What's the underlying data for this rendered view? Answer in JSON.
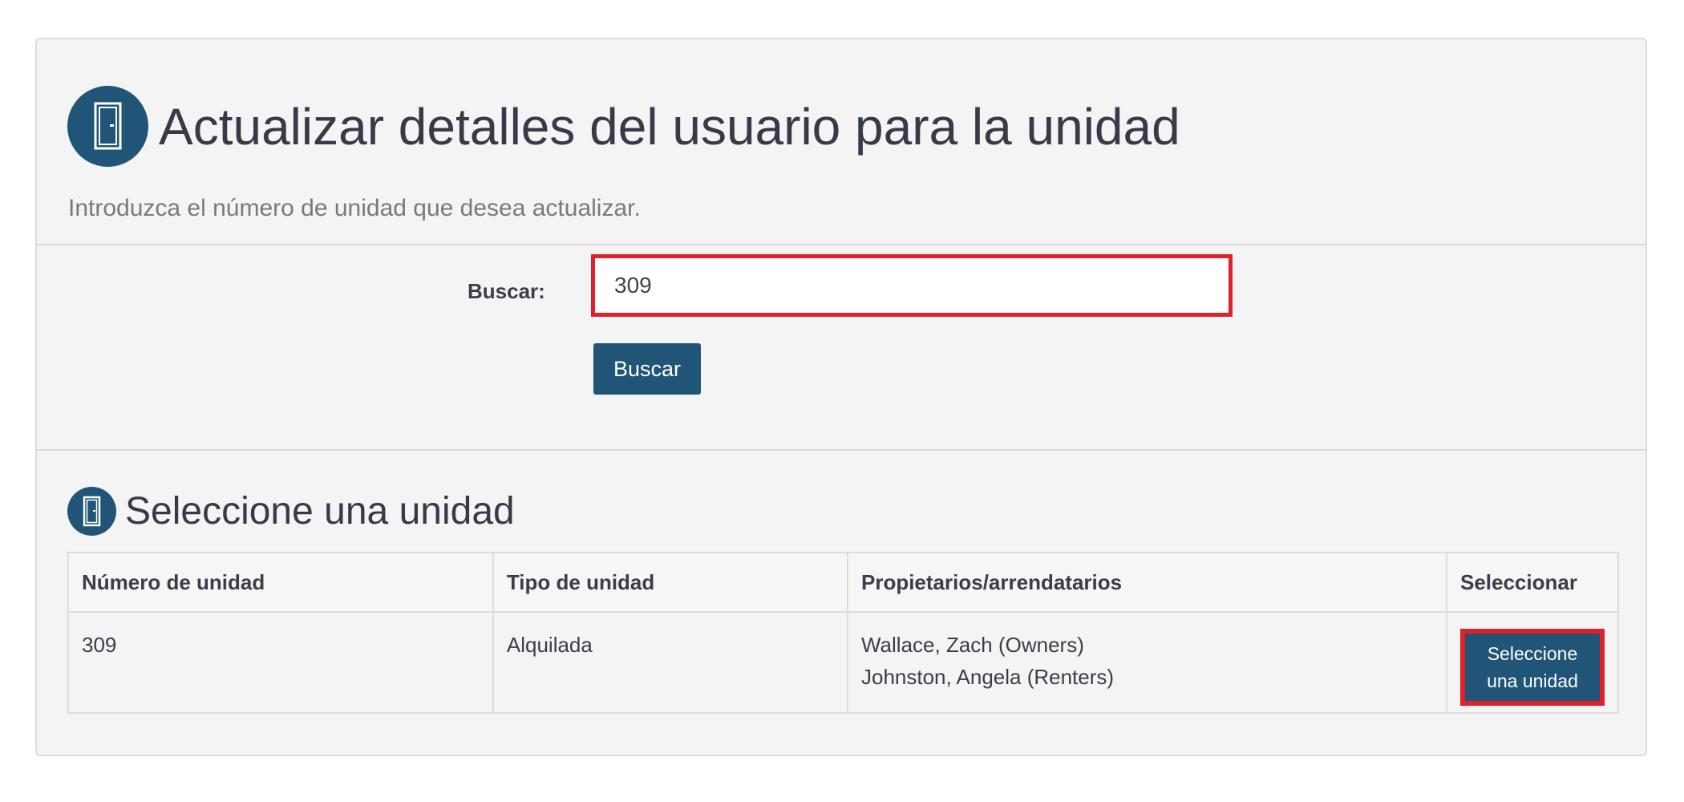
{
  "header": {
    "title": "Actualizar detalles del usuario para la unidad",
    "subtitle": "Introduzca el número de unidad que desea actualizar.",
    "icon": "door-icon"
  },
  "search": {
    "label": "Buscar:",
    "value": "309",
    "button_label": "Buscar"
  },
  "units_section": {
    "title": "Seleccione una unidad",
    "icon": "door-icon",
    "columns": [
      "Número de unidad",
      "Tipo de unidad",
      "Propietarios/arrendatarios",
      "Seleccionar"
    ],
    "rows": [
      {
        "unit_number": "309",
        "unit_type": "Alquilada",
        "owners": [
          "Wallace, Zach (Owners)",
          "Johnston, Angela (Renters)"
        ],
        "select_label": "Seleccione una unidad"
      }
    ]
  },
  "colors": {
    "accent": "#205577",
    "highlight": "#e0202b",
    "panel_bg": "#f4f4f4"
  }
}
